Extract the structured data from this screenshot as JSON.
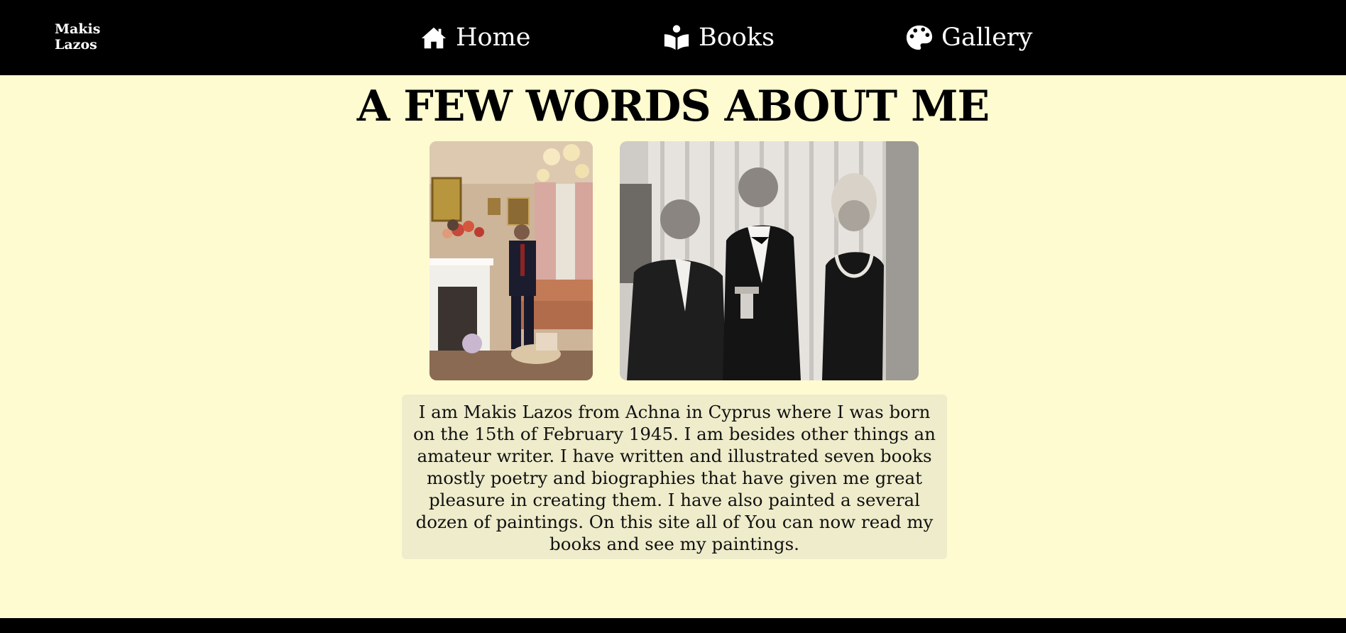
{
  "brand": {
    "line1": "Makis",
    "line2": "Lazos"
  },
  "nav": {
    "home": {
      "label": "Home",
      "icon": "home-icon"
    },
    "books": {
      "label": "Books",
      "icon": "book-reader-icon"
    },
    "gallery": {
      "label": "Gallery",
      "icon": "palette-icon"
    }
  },
  "main": {
    "title": "A FEW WORDS ABOUT ME",
    "bio": "I am Makis Lazos from Achna in Cyprus where I was born on the 15th of February 1945. I am besides other things an amateur writer. I have written and illustrated seven books mostly poetry and biographies that have given me great pleasure in creating them. I have also painted a several dozen of paintings. On this site all of You can now read my books and see my paintings."
  },
  "colors": {
    "page_background": "#fffbd0",
    "navbar": "#000000",
    "bio_box": "#eeeccb",
    "text": "#111111"
  }
}
